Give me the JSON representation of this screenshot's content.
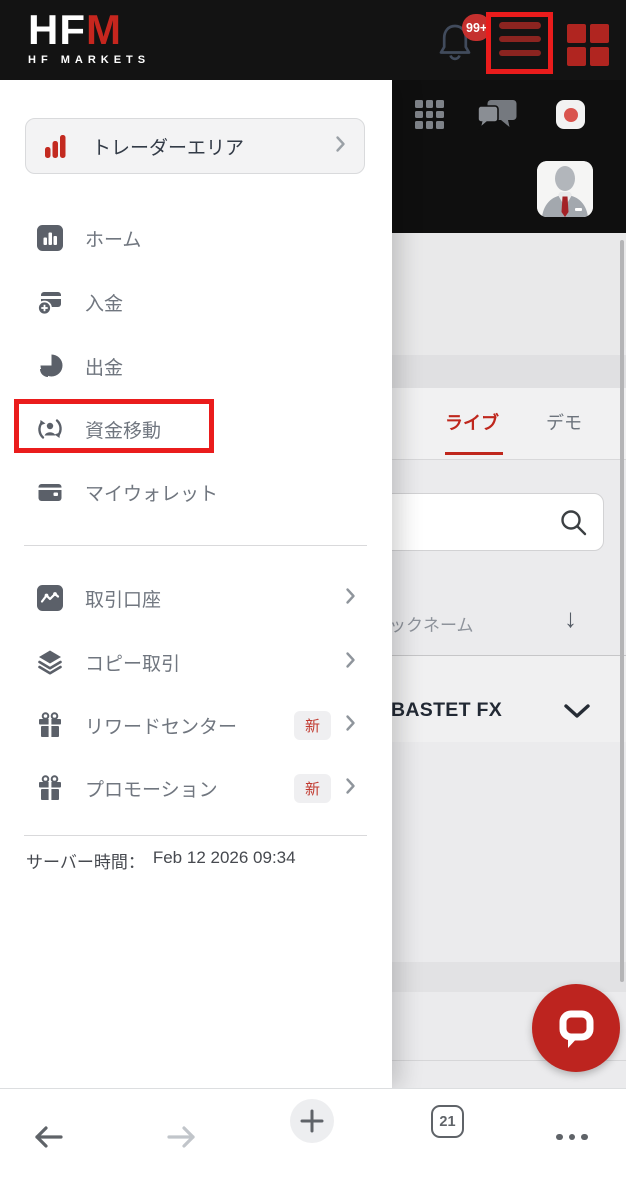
{
  "header": {
    "logo_hf": "HF",
    "logo_m": "M",
    "logo_subtitle": "HF MARKETS",
    "notification_badge": "99+"
  },
  "menu": {
    "trader_area_label": "トレーダーエリア",
    "items": [
      {
        "label": "ホーム",
        "icon": "bar-chart-icon"
      },
      {
        "label": "入金",
        "icon": "deposit-card-icon"
      },
      {
        "label": "出金",
        "icon": "withdraw-pie-icon"
      },
      {
        "label": "資金移動",
        "icon": "transfer-person-icon"
      },
      {
        "label": "マイウォレット",
        "icon": "wallet-icon"
      }
    ],
    "items2": [
      {
        "label": "取引口座",
        "icon": "accounts-chart-icon"
      },
      {
        "label": "コピー取引",
        "icon": "layers-icon"
      },
      {
        "label": "リワードセンター",
        "icon": "gift-icon",
        "badge": "新"
      },
      {
        "label": "プロモーション",
        "icon": "gift-icon",
        "badge": "新"
      }
    ],
    "server_time_label": "サーバー時間：",
    "server_time_value": "Feb 12 2026 09:34"
  },
  "content": {
    "tabs": [
      {
        "label": "ライブ",
        "active": true
      },
      {
        "label": "デモ",
        "active": false
      }
    ],
    "column_header": "ックネーム",
    "sort_arrow": "↓",
    "row_title": "BASTET FX"
  },
  "bottom_nav": {
    "tab_count": "21"
  },
  "colors": {
    "brand_red": "#c6261e",
    "annotation_red": "#ea1c1c",
    "notification_badge_red": "#c5302e",
    "tab_active_red": "#bf271d",
    "fab_red": "#bd241f",
    "header_black": "#131313"
  }
}
